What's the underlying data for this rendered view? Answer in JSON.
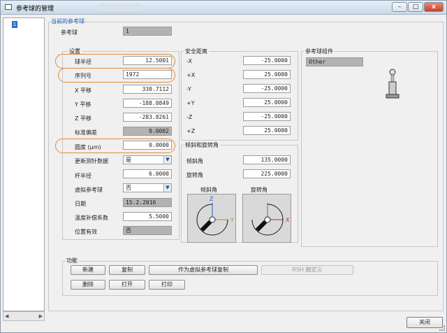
{
  "window": {
    "title": "参考球的管理",
    "min": "–",
    "max": "□",
    "close": "x"
  },
  "list": {
    "selected": "1"
  },
  "current": {
    "section_title": "当前的参考球",
    "ref_ball_label": "参考球",
    "ref_ball_value": "1"
  },
  "settings": {
    "group_label": "设置",
    "radius_label": "球半径",
    "radius_value": "12.5001",
    "serial_label": "序列号",
    "serial_value": "1972",
    "x_shift_label": "X 平移",
    "x_shift_value": "330.7112",
    "y_shift_label": "Y 平移",
    "y_shift_value": "-188.0849",
    "z_shift_label": "Z 平移",
    "z_shift_value": "-283.8261",
    "stddev_label": "标准偏差",
    "stddev_value": "0.0002",
    "roundness_label": "圆度 (μm)",
    "roundness_value": "0.0000",
    "update_probe_label": "更新测针数据",
    "update_probe_value": "是",
    "shaft_radius_label": "杆半径",
    "shaft_radius_value": "6.0000",
    "virtual_ball_label": "虚拟参考球",
    "virtual_ball_value": "否",
    "date_label": "日期",
    "date_value": "15.2.2016",
    "temp_coef_label": "温度补偿系数",
    "temp_coef_value": "5.5000",
    "pos_valid_label": "位置有效",
    "pos_valid_value": "否"
  },
  "safety": {
    "group_label": "安全距离",
    "rows": [
      {
        "axis": "-X",
        "value": "-25.0000"
      },
      {
        "axis": "+X",
        "value": "25.0000"
      },
      {
        "axis": "-Y",
        "value": "-25.0000"
      },
      {
        "axis": "+Y",
        "value": "25.0000"
      },
      {
        "axis": "-Z",
        "value": "-25.0000"
      },
      {
        "axis": "+Z",
        "value": "25.0000"
      }
    ]
  },
  "tilt": {
    "group_label": "倾斜和旋转角",
    "tilt_label": "倾斜角",
    "tilt_value": "135.0000",
    "rot_label": "旋转角",
    "rot_value": "225.0000",
    "tilt_diagram_label": "倾斜角",
    "rot_diagram_label": "旋转角",
    "axis_z": "Z",
    "axis_y": "Y",
    "axis_x": "X"
  },
  "assembly": {
    "group_label": "参考球组件",
    "value": "Other"
  },
  "functions": {
    "group_label": "功能",
    "new": "新建",
    "copy": "复制",
    "copy_virtual": "作为虚拟参考球复制",
    "rsh": "RSH 触定义",
    "delete": "删除",
    "open": "打开",
    "print": "打印"
  },
  "footer": {
    "close": "关闭"
  }
}
